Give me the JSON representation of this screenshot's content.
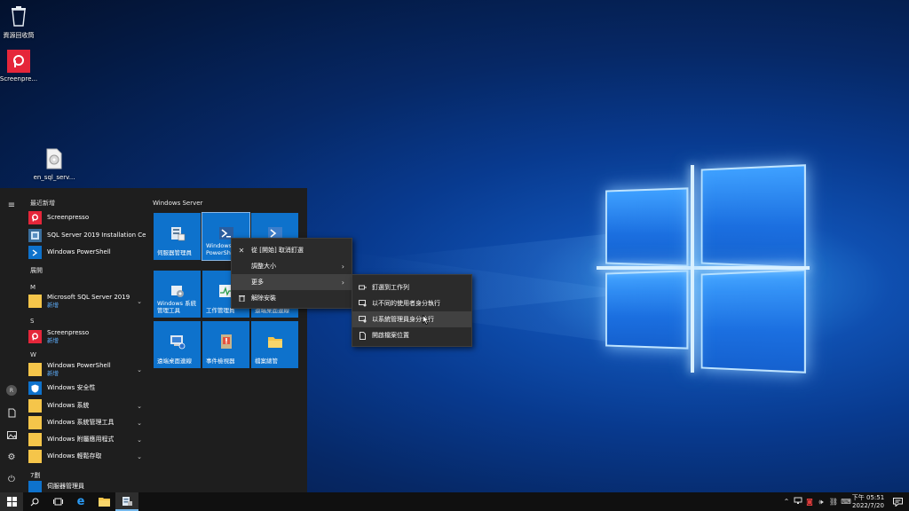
{
  "desktop": {
    "icons": [
      {
        "label": "資源回收筒",
        "icon": "recycle-bin-icon"
      },
      {
        "label": "Screenpre...",
        "icon": "screenpresso-icon"
      },
      {
        "label": "en_sql_serv...",
        "icon": "disc-image-icon"
      }
    ]
  },
  "start_menu": {
    "recent_header": "最近新增",
    "recent": [
      {
        "label": "Screenpresso",
        "icon": "screenpresso-icon"
      },
      {
        "label": "SQL Server 2019 Installation Cent...",
        "icon": "sql-installer-icon"
      },
      {
        "label": "Windows PowerShell",
        "icon": "powershell-icon"
      }
    ],
    "expand_label": "展開",
    "groups": [
      {
        "letter": "M",
        "items": [
          {
            "label": "Microsoft SQL Server 2019",
            "sub": "新增",
            "icon": "folder-icon",
            "chevron": "⌄"
          }
        ]
      },
      {
        "letter": "S",
        "items": [
          {
            "label": "Screenpresso",
            "sub": "新增",
            "icon": "screenpresso-icon"
          }
        ]
      },
      {
        "letter": "W",
        "items": [
          {
            "label": "Windows PowerShell",
            "sub": "新增",
            "icon": "folder-icon",
            "chevron": "⌄"
          },
          {
            "label": "Windows 安全性",
            "icon": "shield-icon"
          },
          {
            "label": "Windows 系統",
            "icon": "folder-icon",
            "chevron": "⌄"
          },
          {
            "label": "Windows 系統管理工具",
            "icon": "folder-icon",
            "chevron": "⌄"
          },
          {
            "label": "Windows 附屬應用程式",
            "icon": "folder-icon",
            "chevron": "⌄"
          },
          {
            "label": "Windows 輕鬆存取",
            "icon": "folder-icon",
            "chevron": "⌄"
          }
        ]
      },
      {
        "letter": "7劃",
        "items": [
          {
            "label": "伺服器管理員",
            "icon": "server-manager-icon"
          }
        ]
      }
    ],
    "rail": {
      "user_initial": "R"
    },
    "tiles_header": "Windows Server",
    "tiles": [
      {
        "label": "伺服器管理員",
        "icon": "server-manager-icon"
      },
      {
        "label": "Windows PowerShe",
        "icon": "powershell-icon"
      },
      {
        "label": "",
        "icon": "powershell-ise-icon"
      },
      {
        "label": "Windows 系統管理工具",
        "icon": "admin-tools-icon"
      },
      {
        "label": "工作管理員",
        "icon": "task-manager-icon"
      },
      {
        "label": "遠端桌面連線",
        "icon": "remote-desktop-icon"
      },
      {
        "label": "事件檢視器",
        "icon": "event-viewer-icon"
      },
      {
        "label": "檔案總管",
        "icon": "file-explorer-icon"
      }
    ]
  },
  "context_menu": {
    "items": [
      {
        "label": "從 [開始] 取消釘選",
        "icon": "unpin-icon"
      },
      {
        "label": "調整大小",
        "icon": "",
        "arrow": "›"
      },
      {
        "label": "更多",
        "icon": "",
        "arrow": "›"
      },
      {
        "label": "解除安裝",
        "icon": "trash-icon"
      }
    ]
  },
  "submenu": {
    "items": [
      {
        "label": "釘選到工作列",
        "icon": "pin-icon"
      },
      {
        "label": "以不同的使用者身分執行",
        "icon": "run-as-icon"
      },
      {
        "label": "以系統管理員身分執行",
        "icon": "run-as-admin-icon"
      },
      {
        "label": "開啟檔案位置",
        "icon": "file-location-icon"
      }
    ]
  },
  "taskbar": {
    "clock_time": "下午 05:51",
    "clock_date": "2022/7/20",
    "colors": {
      "bg": "#101010",
      "accent": "#0e72cc"
    }
  }
}
